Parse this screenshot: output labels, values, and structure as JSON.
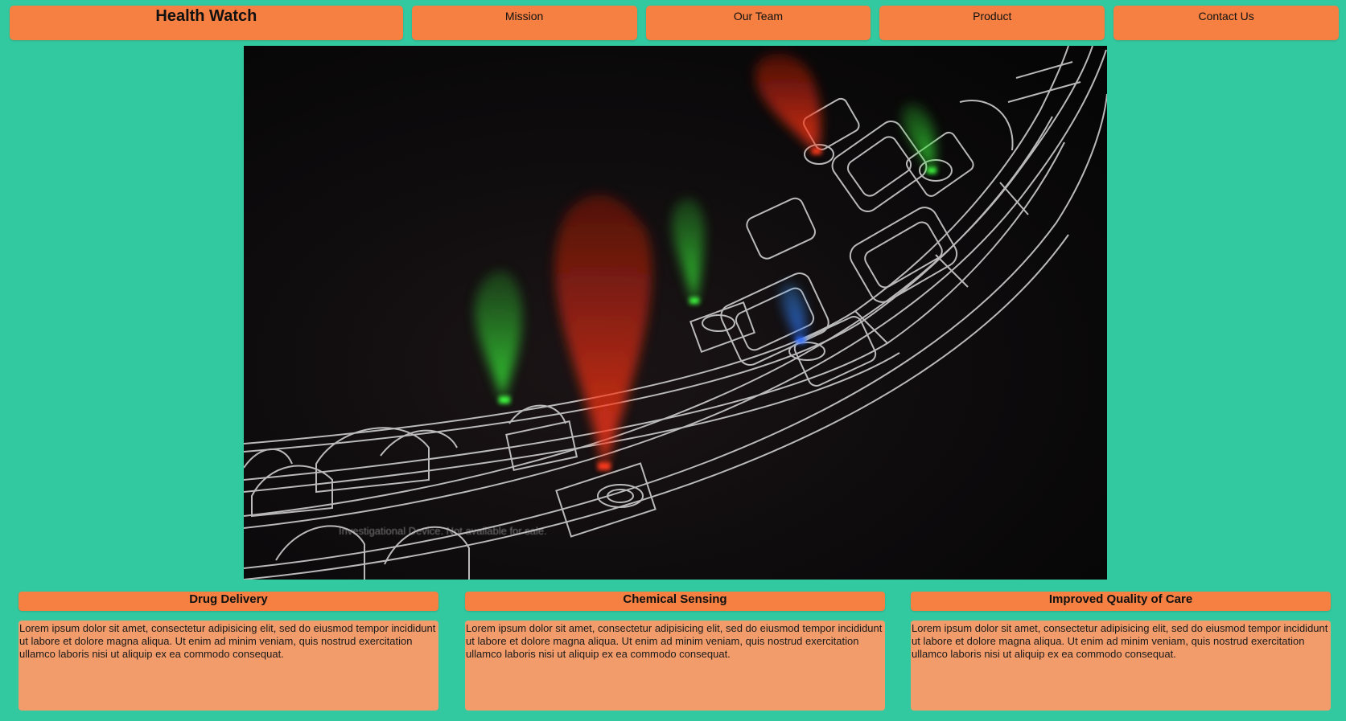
{
  "nav": {
    "brand": "Health Watch",
    "links": [
      "Mission",
      "Our Team",
      "Product",
      "Contact Us"
    ]
  },
  "hero": {
    "caption": "Investigational Device. Not available for sale."
  },
  "cards": [
    {
      "title": "Drug Delivery",
      "body": "Lorem ipsum dolor sit amet, consectetur adipisicing elit, sed do eiusmod tempor incididunt ut labore et dolore magna aliqua. Ut enim ad minim veniam, quis nostrud exercitation ullamco laboris nisi ut aliquip ex ea commodo consequat."
    },
    {
      "title": "Chemical Sensing",
      "body": "Lorem ipsum dolor sit amet, consectetur adipisicing elit, sed do eiusmod tempor incididunt ut labore et dolore magna aliqua. Ut enim ad minim veniam, quis nostrud exercitation ullamco laboris nisi ut aliquip ex ea commodo consequat."
    },
    {
      "title": "Improved Quality of Care",
      "body": "Lorem ipsum dolor sit amet, consectetur adipisicing elit, sed do eiusmod tempor incididunt ut labore et dolore magna aliqua. Ut enim ad minim veniam, quis nostrud exercitation ullamco laboris nisi ut aliquip ex ea commodo consequat."
    }
  ],
  "colors": {
    "background": "#33c9a0",
    "accent": "#f58042",
    "card_body": "#f39c6b"
  }
}
